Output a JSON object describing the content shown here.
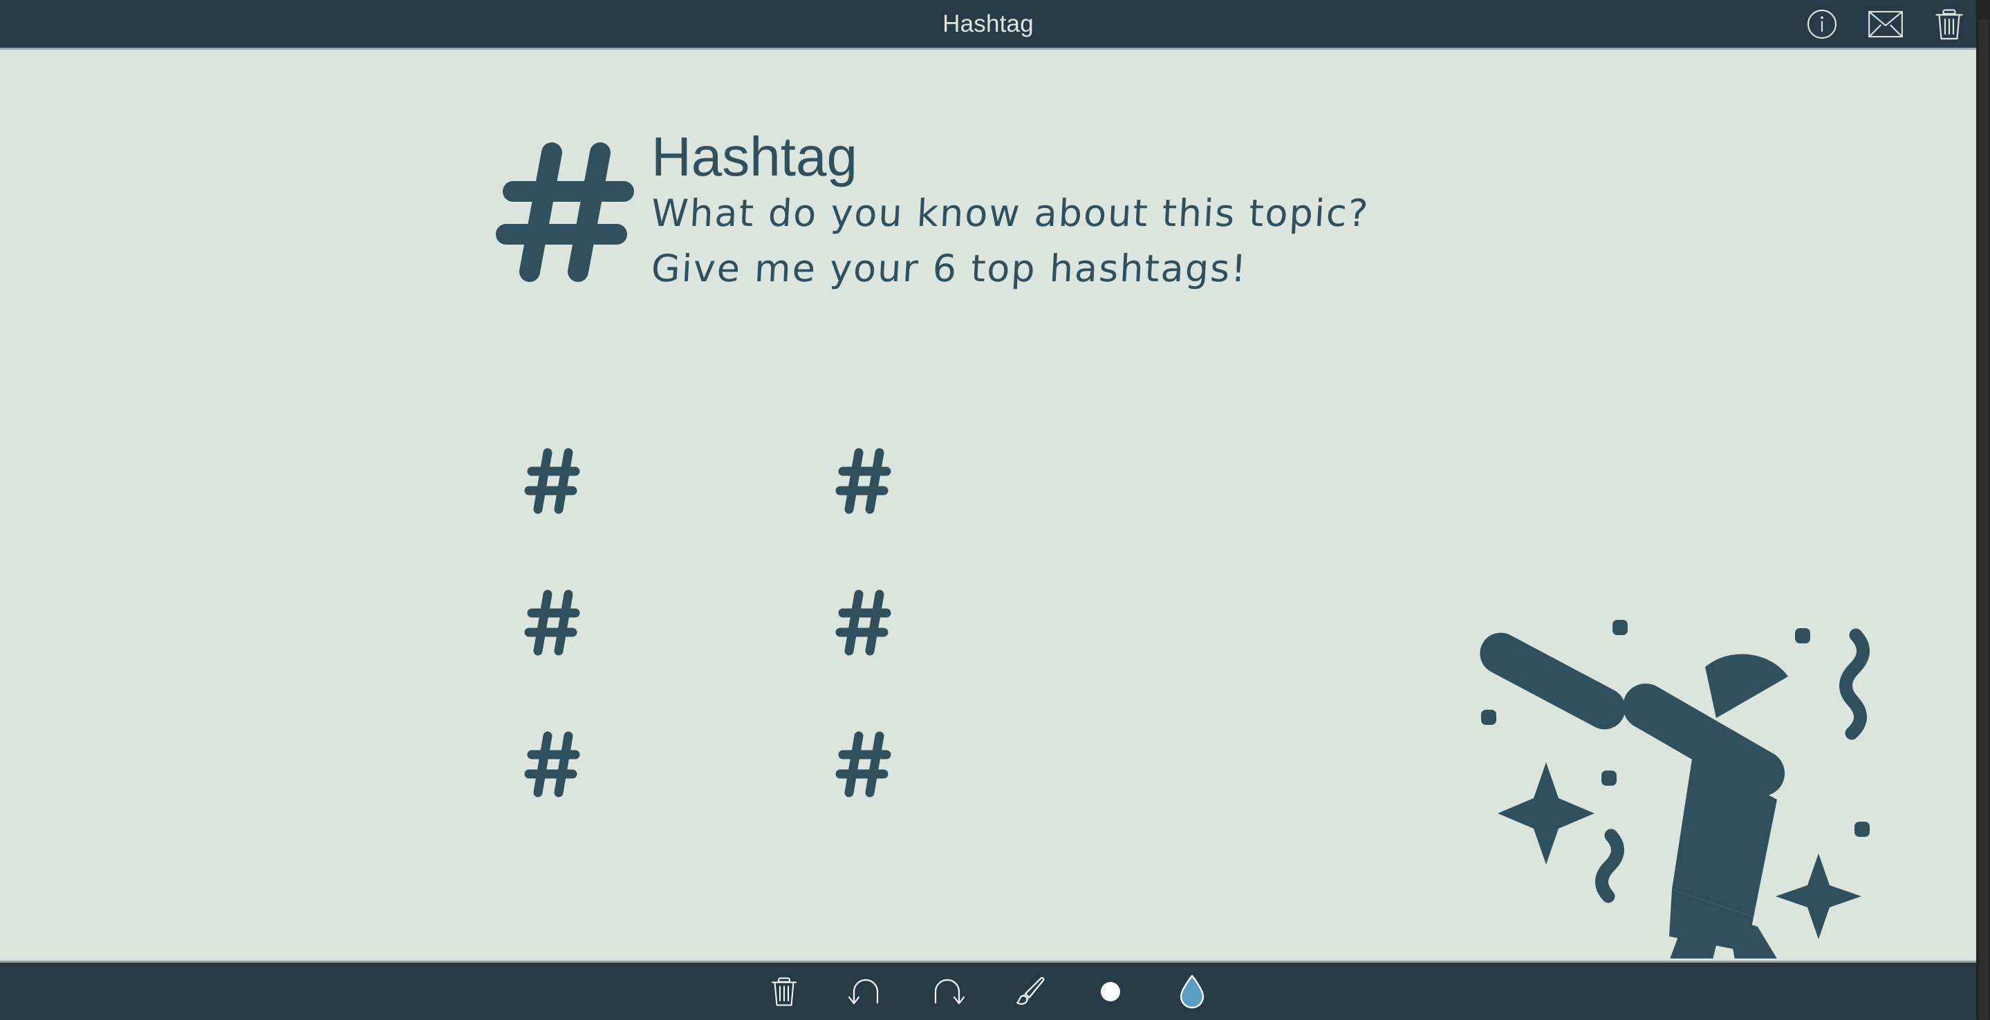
{
  "window": {
    "title": "Hashtag"
  },
  "topbar": {
    "title": "Hashtag",
    "actions": [
      {
        "name": "info-icon",
        "label": "Info"
      },
      {
        "name": "mail-icon",
        "label": "Send by mail"
      },
      {
        "name": "trash-icon",
        "label": "Delete"
      }
    ]
  },
  "sheet": {
    "logo_symbol": "#",
    "title": "Hashtag",
    "prompt_line_1": "What do you know about this topic?",
    "prompt_line_2": "Give me your 6 top hashtags!",
    "slots": [
      {
        "id": "slot-1",
        "marker": "#",
        "value": ""
      },
      {
        "id": "slot-2",
        "marker": "#",
        "value": ""
      },
      {
        "id": "slot-3",
        "marker": "#",
        "value": ""
      },
      {
        "id": "slot-4",
        "marker": "#",
        "value": ""
      },
      {
        "id": "slot-5",
        "marker": "#",
        "value": ""
      },
      {
        "id": "slot-6",
        "marker": "#",
        "value": ""
      }
    ],
    "illustration_name": "dancing-person-illustration"
  },
  "toolbar": {
    "tools": [
      {
        "name": "clear-canvas-button",
        "label": "Clear"
      },
      {
        "name": "undo-button",
        "label": "Undo"
      },
      {
        "name": "redo-button",
        "label": "Redo"
      },
      {
        "name": "brush-tool-button",
        "label": "Brush"
      },
      {
        "name": "brush-size-button",
        "label": "Brush size"
      },
      {
        "name": "color-picker-button",
        "label": "Color"
      }
    ]
  },
  "colors": {
    "bar_background": "#263a48",
    "canvas_background": "#dbe4dd",
    "ink": "#30505e",
    "bar_icon": "#dbe4dd",
    "tool_icon": "#ffffff",
    "selected_color": "#5b9ec4",
    "separator": "#9aa3a8"
  }
}
